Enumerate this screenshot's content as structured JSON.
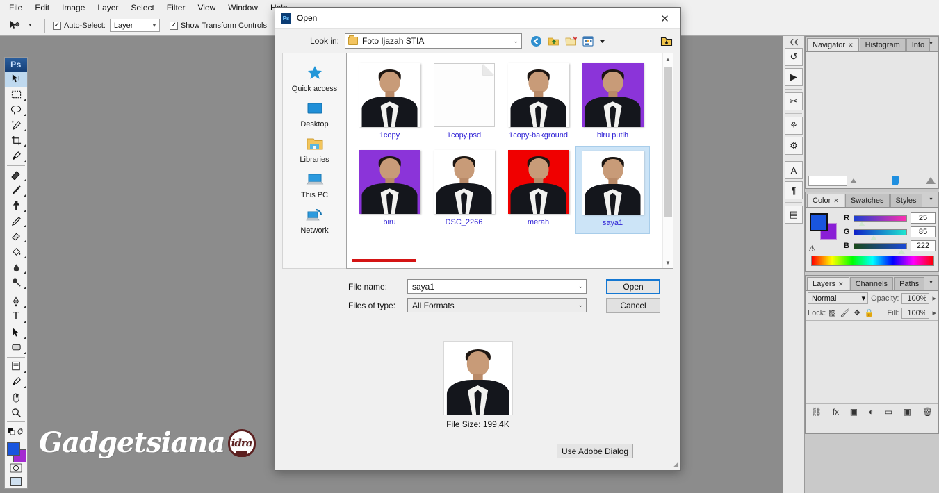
{
  "app": {
    "menus": [
      "File",
      "Edit",
      "Image",
      "Layer",
      "Select",
      "Filter",
      "View",
      "Window",
      "Help"
    ],
    "options_bar": {
      "tool_icon": "move-tool-icon",
      "auto_select_label": "Auto-Select:",
      "auto_select_checked": "✓",
      "layer_select_value": "Layer",
      "show_transform_label": "Show Transform Controls",
      "show_transform_checked": "✓"
    },
    "logo": "Ps",
    "watermark": {
      "text": "Gadgetsiana",
      "badge": "idra"
    }
  },
  "toolbar": {
    "tools": [
      {
        "name": "move-tool",
        "glyph": "✥",
        "active": true
      },
      {
        "name": "marquee-tool",
        "glyph": "▭",
        "active": false
      },
      {
        "name": "lasso-tool",
        "glyph": "◌",
        "active": false
      },
      {
        "name": "quick-selection-tool",
        "glyph": "❧",
        "active": false
      },
      {
        "name": "crop-tool",
        "glyph": "⌗",
        "active": false
      },
      {
        "name": "eyedropper-tool",
        "glyph": "✎",
        "active": false
      },
      {
        "name": "spot-healing-tool",
        "glyph": "✒",
        "active": false
      },
      {
        "name": "brush-tool",
        "glyph": "🖌",
        "active": false
      },
      {
        "name": "clone-stamp-tool",
        "glyph": "⎙",
        "active": false
      },
      {
        "name": "history-brush-tool",
        "glyph": "✍",
        "active": false
      },
      {
        "name": "eraser-tool",
        "glyph": "◨",
        "active": false
      },
      {
        "name": "gradient-tool",
        "glyph": "◧",
        "active": false
      },
      {
        "name": "blur-tool",
        "glyph": "◉",
        "active": false
      },
      {
        "name": "dodge-tool",
        "glyph": "⬤",
        "active": false
      },
      {
        "name": "pen-tool",
        "glyph": "✑",
        "active": false
      },
      {
        "name": "type-tool",
        "glyph": "T",
        "active": false
      },
      {
        "name": "path-selection-tool",
        "glyph": "➤",
        "active": false
      },
      {
        "name": "rectangle-tool",
        "glyph": "▢",
        "active": false
      },
      {
        "name": "notes-tool",
        "glyph": "🗒",
        "active": false
      },
      {
        "name": "color-sampler-tool",
        "glyph": "💉",
        "active": false
      },
      {
        "name": "hand-tool",
        "glyph": "✋",
        "active": false
      },
      {
        "name": "zoom-tool",
        "glyph": "🔍",
        "active": false
      }
    ],
    "foreground_color": "#1955de",
    "background_color": "#a42ad1",
    "quick_mask_glyph": "◎",
    "screen_mode_glyph": "▣"
  },
  "dock_rail": {
    "buttons": [
      "history-icon",
      "actions-icon",
      "tool-presets-icon",
      "clone-source-icon",
      "brush-settings-icon",
      "character-icon",
      "paragraph-icon",
      "layer-comps-icon"
    ],
    "glyphs": [
      "↺",
      "▶",
      "✂",
      "⚘",
      "⚙",
      "A",
      "¶",
      "▤"
    ]
  },
  "panels": {
    "navigator": {
      "tabs": [
        {
          "label": "Navigator",
          "closable": true,
          "active": true
        },
        {
          "label": "Histogram",
          "closable": false,
          "active": false
        },
        {
          "label": "Info",
          "closable": false,
          "active": false
        }
      ],
      "zoom_value": ""
    },
    "color": {
      "tabs": [
        {
          "label": "Color",
          "closable": true,
          "active": true
        },
        {
          "label": "Swatches",
          "closable": false,
          "active": false
        },
        {
          "label": "Styles",
          "closable": false,
          "active": false
        }
      ],
      "channels": [
        {
          "label": "R",
          "value": "25"
        },
        {
          "label": "G",
          "value": "85"
        },
        {
          "label": "B",
          "value": "222"
        }
      ],
      "foreground": "#1955de",
      "background": "#8a1ed6",
      "out_of_gamut_glyph": "⚠"
    },
    "layers": {
      "tabs": [
        {
          "label": "Layers",
          "closable": true,
          "active": true
        },
        {
          "label": "Channels",
          "closable": false,
          "active": false
        },
        {
          "label": "Paths",
          "closable": false,
          "active": false
        }
      ],
      "blend_mode": "Normal",
      "opacity_label": "Opacity:",
      "opacity_value": "100%",
      "lock_label": "Lock:",
      "lock_icons": [
        "▨",
        "🖌",
        "✥",
        "🔒"
      ],
      "fill_label": "Fill:",
      "fill_value": "100%",
      "footer_icons": [
        "link-icon",
        "fx-icon",
        "mask-icon",
        "adjustment-icon",
        "group-icon",
        "new-layer-icon",
        "delete-icon"
      ],
      "footer_glyphs": [
        "⛓",
        "fx",
        "▣",
        "◐",
        "▭",
        "▣",
        "🗑"
      ]
    }
  },
  "dialog": {
    "title": "Open",
    "close_glyph": "✕",
    "look_in_label": "Look in:",
    "look_in_value": "Foto Ijazah STIA",
    "toolbar_icons": [
      {
        "name": "back-icon",
        "glyph": "◀"
      },
      {
        "name": "up-folder-icon",
        "glyph": "⬆"
      },
      {
        "name": "new-folder-icon",
        "glyph": "📁"
      },
      {
        "name": "view-mode-icon",
        "glyph": "▦"
      },
      {
        "name": "view-mode-caret-icon",
        "glyph": "▾"
      },
      {
        "name": "add-favorite-icon",
        "glyph": "▣"
      }
    ],
    "places": [
      {
        "label": "Quick access",
        "icon": "star-icon",
        "glyph": "★"
      },
      {
        "label": "Desktop",
        "icon": "desktop-icon",
        "glyph": "▬"
      },
      {
        "label": "Libraries",
        "icon": "libraries-icon",
        "glyph": "📂"
      },
      {
        "label": "This PC",
        "icon": "this-pc-icon",
        "glyph": "🖥"
      },
      {
        "label": "Network",
        "icon": "network-icon",
        "glyph": "🌐"
      }
    ],
    "files": [
      {
        "name": "1copy",
        "kind": "photo",
        "bg": "white",
        "selected": false
      },
      {
        "name": "1copy.psd",
        "kind": "document",
        "bg": "doc",
        "selected": false
      },
      {
        "name": "1copy-bakground",
        "kind": "photo",
        "bg": "white",
        "selected": false
      },
      {
        "name": "biru putih",
        "kind": "photo",
        "bg": "purple",
        "selected": false
      },
      {
        "name": "biru",
        "kind": "photo",
        "bg": "purple",
        "selected": false
      },
      {
        "name": "DSC_2266",
        "kind": "photo",
        "bg": "white",
        "selected": false
      },
      {
        "name": "merah",
        "kind": "photo",
        "bg": "red",
        "selected": false
      },
      {
        "name": "saya1",
        "kind": "photo",
        "bg": "white",
        "selected": true
      }
    ],
    "file_name_label": "File name:",
    "file_name_value": "saya1",
    "files_of_type_label": "Files of type:",
    "files_of_type_value": "All Formats",
    "open_button": "Open",
    "cancel_button": "Cancel",
    "preview_caption": "File Size: 199,4K",
    "use_adobe_dialog_button": "Use Adobe Dialog",
    "selection_highlight_color": "#cce4f7",
    "file_label_color": "#3124d6",
    "marker_color": "#d41414"
  }
}
